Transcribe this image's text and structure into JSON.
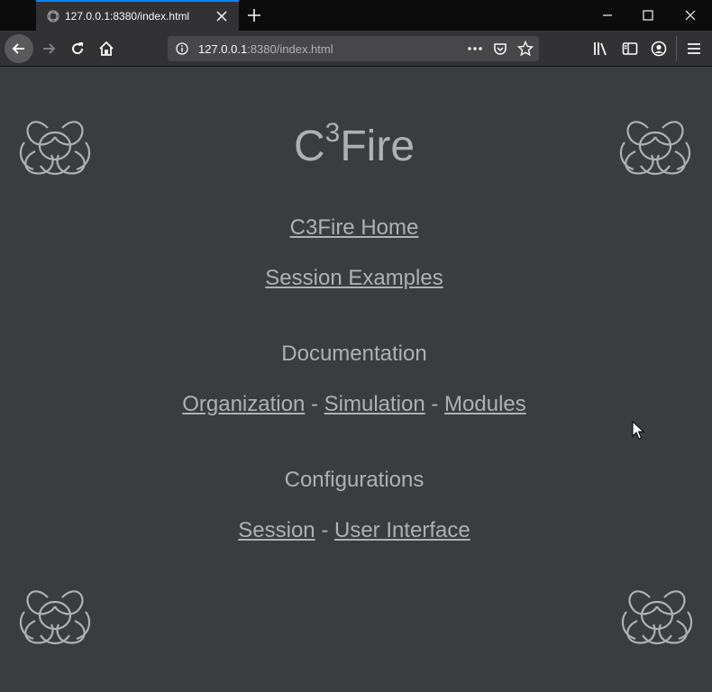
{
  "browser": {
    "tab_title": "127.0.0.1:8380/index.html",
    "url_host": "127.0.0.1",
    "url_rest": ":8380/index.html"
  },
  "page": {
    "title_base": "C",
    "title_sup": "3",
    "title_rest": "Fire",
    "home_link": "C3Fire Home",
    "examples_link": "Session Examples",
    "documentation_heading": "Documentation",
    "doc_links": [
      "Organization",
      "Simulation",
      "Modules"
    ],
    "configurations_heading": "Configurations",
    "config_links": [
      "Session",
      "User Interface"
    ],
    "separator": "-"
  },
  "colors": {
    "page_background": "#3a3d40",
    "text": "#aeb1b4",
    "tab_accent": "#0a84ff"
  }
}
